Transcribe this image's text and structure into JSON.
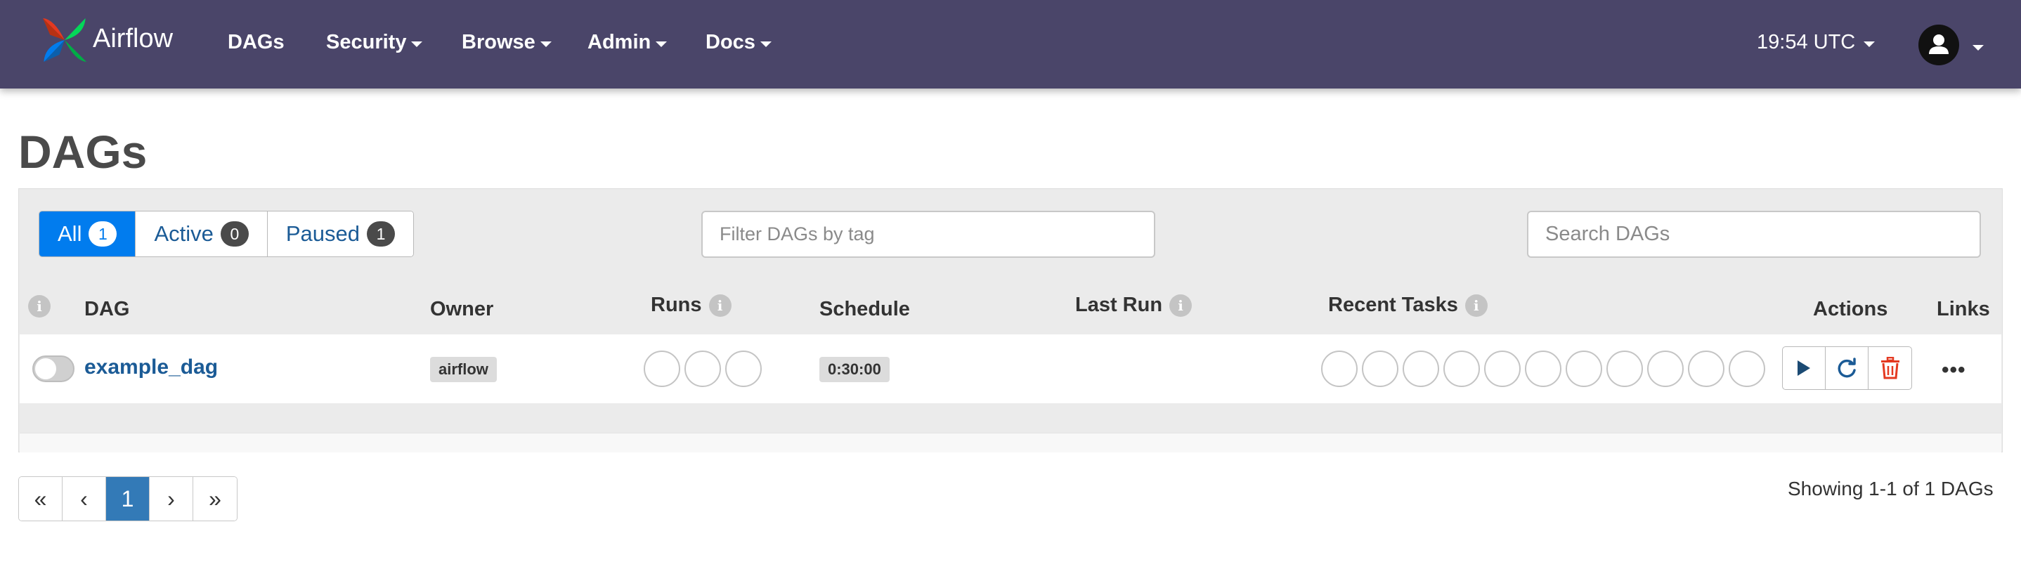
{
  "navbar": {
    "brand": "Airflow",
    "items": [
      {
        "label": "DAGs",
        "dropdown": false
      },
      {
        "label": "Security",
        "dropdown": true
      },
      {
        "label": "Browse",
        "dropdown": true
      },
      {
        "label": "Admin",
        "dropdown": true
      },
      {
        "label": "Docs",
        "dropdown": true
      }
    ],
    "clock": "19:54 UTC",
    "colors": {
      "background": "#4a4569"
    }
  },
  "page": {
    "title": "DAGs"
  },
  "filters": {
    "status_tabs": [
      {
        "label": "All",
        "count": "1",
        "active": true
      },
      {
        "label": "Active",
        "count": "0",
        "active": false
      },
      {
        "label": "Paused",
        "count": "1",
        "active": false
      }
    ],
    "tag_placeholder": "Filter DAGs by tag",
    "search_placeholder": "Search DAGs"
  },
  "table": {
    "headers": {
      "dag": "DAG",
      "owner": "Owner",
      "runs": "Runs",
      "schedule": "Schedule",
      "last_run": "Last Run",
      "recent_tasks": "Recent Tasks",
      "actions": "Actions",
      "links": "Links"
    },
    "rows": [
      {
        "dag_id": "example_dag",
        "owner": "airflow",
        "schedule": "0:30:00",
        "last_run": "",
        "paused": true,
        "run_states": 3,
        "task_states": 11
      }
    ]
  },
  "actions": {
    "trigger_icon": "play-icon",
    "refresh_icon": "refresh-icon",
    "delete_icon": "trash-icon",
    "more_label": "•••"
  },
  "pagination": {
    "first": "«",
    "prev": "‹",
    "current": "1",
    "next": "›",
    "last": "»",
    "summary": "Showing 1-1 of 1 DAGs"
  },
  "colors": {
    "accent": "#017cee",
    "link": "#1b5b96",
    "delete": "#e43921",
    "page_active": "#337ab7"
  }
}
